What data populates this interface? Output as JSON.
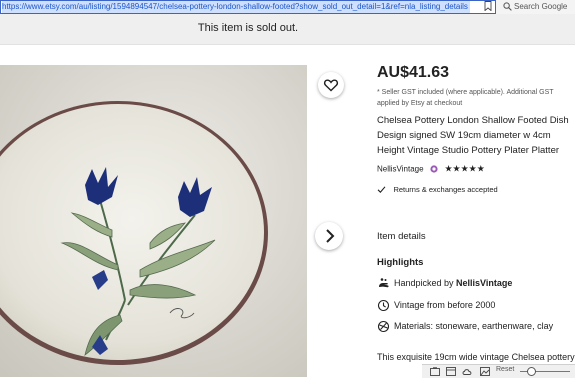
{
  "browser": {
    "url": "https://www.etsy.com/au/listing/1594894547/chelsea-pottery-london-shallow-footed?show_sold_out_detail=1&ref=nla_listing_details",
    "search_placeholder": "Search Google"
  },
  "banner": {
    "text": "This item is sold out."
  },
  "listing": {
    "price": "AU$41.63",
    "gst_note": "* Seller GST included (where applicable). Additional GST applied by Etsy at checkout",
    "title": "Chelsea Pottery London Shallow Footed Dish Design signed SW 19cm diameter w 4cm Height Vintage Studio Pottery Plater Platter",
    "shop_name": "NellisVintage",
    "stars": "★★★★★",
    "returns": "Returns & exchanges accepted",
    "item_details_label": "Item details",
    "highlights_label": "Highlights",
    "highlights": [
      {
        "icon": "hand-icon",
        "prefix": "Handpicked by ",
        "bold": "NellisVintage"
      },
      {
        "icon": "clock-icon",
        "prefix": "Vintage from before 2000",
        "bold": ""
      },
      {
        "icon": "materials-icon",
        "prefix": "Materials: stoneware, earthenware, clay",
        "bold": ""
      }
    ],
    "description_start": "This exquisite 19cm wide vintage Chelsea pottery"
  },
  "statusbar": {
    "reset_label": "Reset"
  },
  "colors": {
    "url_border": "#3a64c6",
    "url_text": "#1a55c8",
    "url_highlight": "#cfe0ff",
    "banner_bg": "#efefef",
    "badge": "#9b59b6"
  }
}
